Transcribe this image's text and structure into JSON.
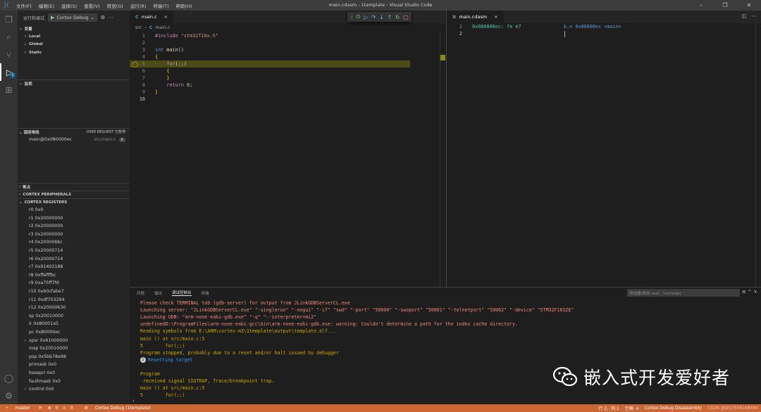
{
  "titlebar": {
    "menus": [
      "文件(F)",
      "编辑(E)",
      "选择(S)",
      "查看(V)",
      "转到(G)",
      "运行(R)",
      "终端(T)",
      "帮助(H)"
    ],
    "title": "main.cdasm - 1template - Visual Studio Code"
  },
  "sidebar": {
    "run_title": "运行和调试",
    "config": "Cortex Debug",
    "variables_title": "变量",
    "scopes": [
      "Local",
      "Global",
      "Static"
    ],
    "watch_title": "监视",
    "callstack_title": "调用堆栈",
    "callstack_status": "USER REQUEST 已暂停",
    "frame": {
      "name": "main@0x080000ec",
      "file": "src/main.c",
      "line": "5"
    },
    "breakpoints_title": "断点",
    "peripherals_title": "CORTEX PERIPHERALS",
    "registers_title": "CORTEX REGISTERS",
    "registers": [
      {
        "t": "",
        "v": "r0 0x0"
      },
      {
        "t": "",
        "v": "r1 0x20000000"
      },
      {
        "t": "",
        "v": "r2 0x20000000"
      },
      {
        "t": "",
        "v": "r3 0x20000000"
      },
      {
        "t": "",
        "v": "r4 0x200006bc"
      },
      {
        "t": "",
        "v": "r5 0x20000714"
      },
      {
        "t": "",
        "v": "r6 0x20000714"
      },
      {
        "t": "",
        "v": "r7 0x91402188"
      },
      {
        "t": "",
        "v": "r8 0xffefffbc"
      },
      {
        "t": "",
        "v": "r9 0xa75ff7fd"
      },
      {
        "t": "",
        "v": "r10 0xb0cfabe7"
      },
      {
        "t": "",
        "v": "r11 0xdf703294"
      },
      {
        "t": "",
        "v": "r12 0x20000630"
      },
      {
        "t": "",
        "v": "sp 0x20010000"
      },
      {
        "t": "",
        "v": "lr 0x80001a5"
      },
      {
        "t": "",
        "v": "pc 0x80000ec"
      },
      {
        "t": "›",
        "v": "xpsr 0x61000000"
      },
      {
        "t": "",
        "v": "msp 0x20010000"
      },
      {
        "t": "",
        "v": "psp 0x5bb78e98"
      },
      {
        "t": "",
        "v": "primask 0x0"
      },
      {
        "t": "",
        "v": "basepri 0x0"
      },
      {
        "t": "",
        "v": "faultmask 0x0"
      },
      {
        "t": "›",
        "v": "control 0x0"
      }
    ]
  },
  "editor1": {
    "tab": "main.c",
    "crumb_root": "src",
    "crumb_file": "main.c",
    "lines": [
      {
        "n": "1",
        "t": "#include \"stm32f10x.h\""
      },
      {
        "n": "2",
        "t": ""
      },
      {
        "n": "3",
        "t": "int main()"
      },
      {
        "n": "4",
        "t": "{"
      },
      {
        "n": "5",
        "t": "    for(;;)"
      },
      {
        "n": "6",
        "t": "    {"
      },
      {
        "n": "7",
        "t": "    }"
      },
      {
        "n": "8",
        "t": "    return 0;"
      },
      {
        "n": "9",
        "t": "}"
      },
      {
        "n": "10",
        "t": ""
      }
    ]
  },
  "editor2": {
    "tab": "main.cdasm",
    "lines": [
      {
        "n": "1",
        "addr": "0x080000ec: fe e7",
        "ins": "b.n 0x80000ec <main>"
      },
      {
        "n": "2",
        "addr": "",
        "ins": ""
      }
    ]
  },
  "panel": {
    "tabs": [
      "问题",
      "输出",
      "调试控制台",
      "终端"
    ],
    "filter_placeholder": "筛选器(例如 text、!exclude)",
    "lines": [
      {
        "c": "o-red",
        "t": "Please check TERMINAL tab (gdb-server) for output from JLinkGDBServerCL.exe"
      },
      {
        "c": "o-red",
        "t": "Launching server: \"JLinkGDBServerCL.exe\" \"-singlerun\" \"-nogui\" \"-if\" \"swd\" \"-port\" \"50000\" \"-swoport\" \"50001\" \"-telnetport\" \"50002\" \"-device\" \"STM32F103ZE\""
      },
      {
        "c": "o-red",
        "t": "Launching GDB: \"arm-none-eabi-gdb.exe\" \"-q\" \"--interpreter=mi2\""
      },
      {
        "c": "o-red",
        "t": "undefinedD:\\ProgramFiles\\arm-none-eabi-gcc\\bin\\arm-none-eabi-gdb.exe: warning: Couldn't determine a path for the index cache directory."
      },
      {
        "c": "o-yel",
        "t": "Reading symbols from E:\\ARM\\cortex-m3\\1template\\output\\template.elf..."
      },
      {
        "c": "o-yel",
        "t": "main () at src/main.c:5"
      },
      {
        "c": "o-yel",
        "t": "5\t\tfor(;;)"
      },
      {
        "c": "o-yel",
        "t": "Program stopped, probably due to a reset and/or halt issued by debugger"
      },
      {
        "c": "o-blu",
        "t": "Resetting target",
        "b": "2"
      },
      {
        "c": "o-yel",
        "t": ""
      },
      {
        "c": "o-yel",
        "t": "Program"
      },
      {
        "c": "o-yel",
        "t": " received signal SIGTRAP, Trace/breakpoint trap."
      },
      {
        "c": "o-yel",
        "t": "main () at src/main.c:5"
      },
      {
        "c": "o-yel",
        "t": "5\t\tfor(;;)"
      }
    ]
  },
  "statusbar": {
    "branch": "master",
    "errors": "0",
    "warnings": "0",
    "config": "Cortex Debug (1template)",
    "position": "行 2，列 1",
    "spaces": "空格: 4",
    "mode": "Cortex Debug Disassembly",
    "csdn": "CSDN @sfq7956168484"
  },
  "watermark": {
    "text": "嵌入式开发爱好者"
  },
  "colors": {
    "statusbar": "#cc6633",
    "accent": "#0e639c",
    "activity": "#333333",
    "sidebar": "#252526",
    "editor": "#1e1e1e"
  }
}
